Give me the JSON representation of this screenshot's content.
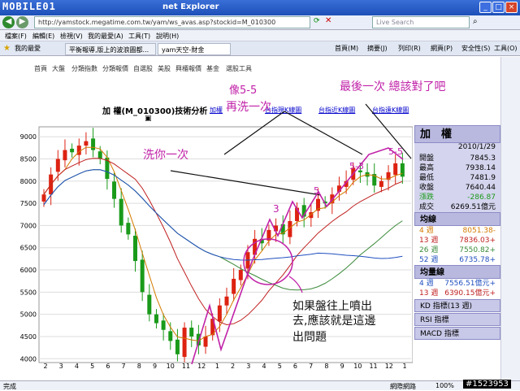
{
  "window": {
    "title": "net Explorer",
    "logo": "MOBILE01"
  },
  "address": {
    "url": "http://yamstock.megatime.com.tw/yam/ws_avas.asp?stockid=M_010300",
    "search_placeholder": "Live Search"
  },
  "menu": [
    "檔案(F)",
    "編輯(E)",
    "檢視(V)",
    "我的最愛(A)",
    "工具(T)",
    "說明(H)"
  ],
  "tabs": {
    "favorites": "我的最愛",
    "tab1": "平衡報導,版上的波浪圖都...",
    "tab2": "yam天空-財金",
    "tools": [
      "首頁(M)",
      "摘要(J)",
      "列印(R)",
      "網頁(P)",
      "安全性(S)",
      "工具(O)"
    ]
  },
  "site_nav": [
    "首頁",
    "大盤",
    "分類指數",
    "分類報價",
    "自選股",
    "美股",
    "興櫃報價",
    "基金",
    "選股工具"
  ],
  "chart": {
    "title": "加 權(M_010300)技術分析",
    "links": [
      "加權",
      "台指現K線圖",
      "台指近K線圖",
      "台指遠K線圖"
    ]
  },
  "annotations": {
    "a1": "像5-5",
    "a2": "再洗一次",
    "a3": "最後一次 總該對了吧",
    "a4": "洗你一次",
    "a5": "如果盤往上噴出",
    "a6": "去,應該就是這邊",
    "a7": "出問題",
    "w1": "5-3",
    "w2": "5-5",
    "w3": "3",
    "w4": "5"
  },
  "chart_data": {
    "type": "candlestick",
    "title": "加 權(M_010300)技術分析",
    "x_ticks": [
      "2",
      "3",
      "4",
      "5",
      "6",
      "7",
      "8",
      "9",
      "10",
      "11",
      "12",
      "1",
      "2",
      "3",
      "4",
      "5",
      "6",
      "7",
      "8",
      "9",
      "10",
      "11",
      "12",
      "1"
    ],
    "y_ticks": [
      9000,
      8500,
      8000,
      7500,
      7000,
      6500,
      6000,
      5500,
      5000,
      4500,
      4000
    ],
    "ylim": [
      3950,
      9150
    ],
    "close_path": [
      7700,
      8150,
      8500,
      8700,
      8650,
      8800,
      8900,
      8700,
      8500,
      8050,
      7600,
      7000,
      6800,
      6200,
      5500,
      5000,
      4800,
      4650,
      4400,
      4100,
      4700,
      4500,
      4300,
      4500,
      4900,
      5200,
      5400,
      5800,
      6000,
      6400,
      6700,
      6600,
      6900,
      7000,
      6800,
      7100,
      7400,
      7200,
      7300,
      7600,
      7500,
      7700,
      7900,
      8000,
      8300,
      8200,
      8100,
      7900,
      8000,
      8200,
      8400,
      8100
    ]
  },
  "side": {
    "name": "加　權",
    "date": "2010/1/29",
    "rows": [
      {
        "k": "開盤",
        "v": "7845.3"
      },
      {
        "k": "最高",
        "v": "7938.14"
      },
      {
        "k": "最低",
        "v": "7481.9"
      },
      {
        "k": "收盤",
        "v": "7640.44"
      },
      {
        "k": "漲跌",
        "v": "-286.87"
      },
      {
        "k": "成交",
        "v": "6269.51億元"
      }
    ],
    "ma_head": "均線",
    "ma": [
      {
        "k": "4 週",
        "v": "8051.38-"
      },
      {
        "k": "13 週",
        "v": "7836.03+"
      },
      {
        "k": "26 週",
        "v": "7550.82+"
      },
      {
        "k": "52 週",
        "v": "6735.78+"
      }
    ],
    "vol_head": "均量線",
    "vol": [
      {
        "k": "4 週",
        "v": "7556.51億元+"
      },
      {
        "k": "13 週",
        "v": "6390.15億元+"
      }
    ],
    "buttons": [
      "KD 指標(13 週)",
      "RSI 指標",
      "MACD 指標"
    ]
  },
  "status": {
    "left": "完成",
    "zone": "網際網路",
    "zoom": "100%",
    "id": "#1523953"
  }
}
